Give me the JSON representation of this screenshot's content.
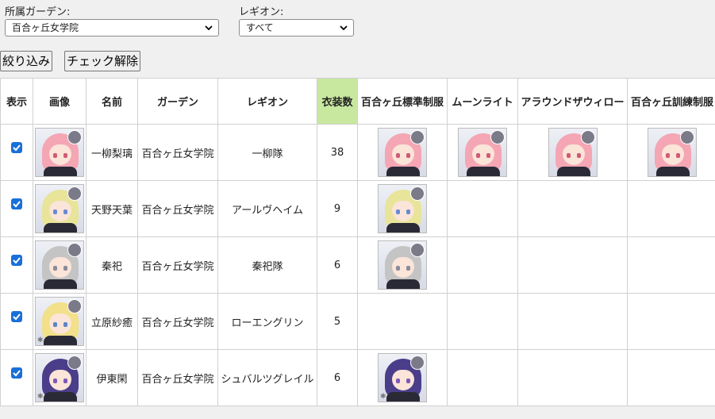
{
  "filters": {
    "garden_label": "所属ガーデン:",
    "garden_value": "百合ヶ丘女学院",
    "legion_label": "レギオン:",
    "legion_value": "すべて"
  },
  "buttons": {
    "filter": "絞り込み",
    "uncheck": "チェック解除"
  },
  "table": {
    "headers": [
      "表示",
      "画像",
      "名前",
      "ガーデン",
      "レギオン",
      "衣装数",
      "百合ヶ丘標準制服",
      "ムーンライト",
      "アラウンドザウィロー",
      "百合ヶ丘訓練制服"
    ],
    "rows": [
      {
        "name": "一柳梨璃",
        "garden": "百合ヶ丘女学院",
        "legion": "一柳隊",
        "count": "38",
        "checked": true,
        "hair": "#f4a6b4",
        "eye": "#d05a78",
        "costumes": [
          true,
          true,
          true,
          true
        ]
      },
      {
        "name": "天野天葉",
        "garden": "百合ヶ丘女学院",
        "legion": "アールヴヘイム",
        "count": "9",
        "checked": true,
        "hair": "#e8e49a",
        "eye": "#6a8ad0",
        "costumes": [
          true,
          false,
          false,
          false
        ]
      },
      {
        "name": "秦祀",
        "garden": "百合ヶ丘女学院",
        "legion": "秦祀隊",
        "count": "6",
        "checked": true,
        "hair": "#c4c4c4",
        "eye": "#8a8a9a",
        "costumes": [
          true,
          false,
          false,
          false
        ]
      },
      {
        "name": "立原紗癒",
        "garden": "百合ヶ丘女学院",
        "legion": "ローエングリン",
        "count": "5",
        "checked": true,
        "hair": "#f2e08a",
        "eye": "#5a86c8",
        "costumes": [
          false,
          false,
          false,
          false
        ]
      },
      {
        "name": "伊東閑",
        "garden": "百合ヶ丘女学院",
        "legion": "シュバルツグレイル",
        "count": "6",
        "checked": true,
        "hair": "#4a3e8a",
        "eye": "#7a5ab8",
        "costumes": [
          true,
          false,
          false,
          false
        ]
      }
    ]
  },
  "colors": {
    "sorted_header": "#c8e8a0",
    "checkbox": "#1a6fd8"
  }
}
